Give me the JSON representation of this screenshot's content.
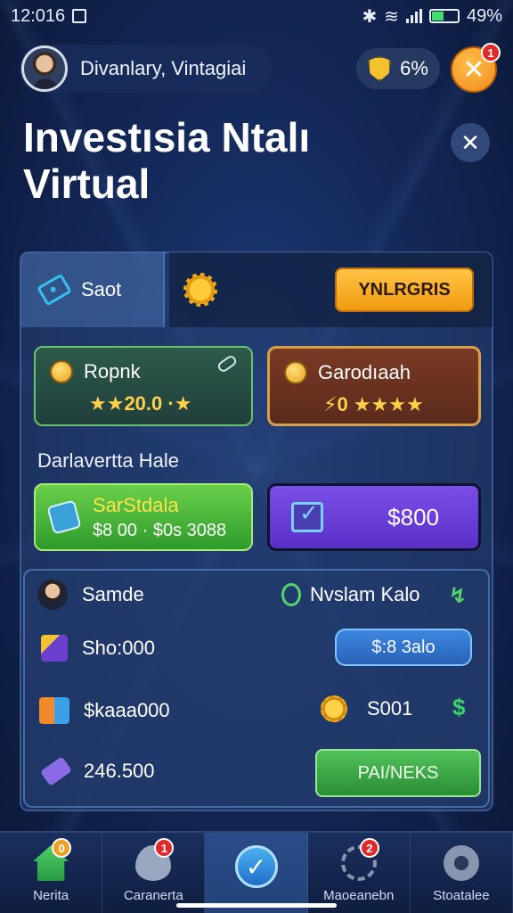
{
  "status_bar": {
    "time": "12:016",
    "battery": "49%"
  },
  "header": {
    "profile_name": "Divanlary, Vintagiai",
    "shield_value": "6%",
    "close_badge": "1"
  },
  "title": "Investısia Ntalı Virtual",
  "tabs": {
    "sort_label": "Saot",
    "action_button": "YNLRGRIS"
  },
  "cards": {
    "green": {
      "label": "Ropnk",
      "value": "★★20.0 ·★"
    },
    "brown": {
      "label": "Garodıaah",
      "value": "⚡0 ★★★★"
    }
  },
  "section": {
    "label": "Darlavertta Hale",
    "green_button": {
      "line1": "SarStdala",
      "line2": "$8 00 · $0s 3088"
    },
    "purple_button": "$800"
  },
  "list": {
    "row1": {
      "name": "Samde",
      "right": "Nvslam Kalo"
    },
    "row2": {
      "value": "Sho:000",
      "button": "$:8 3alo"
    },
    "row3": {
      "value": "$kaaa000",
      "right": "S001"
    },
    "row4": {
      "value": "246.500",
      "button": "PAI/NEKS"
    }
  },
  "bottom_nav": [
    {
      "label": "Nerita",
      "badge": "0"
    },
    {
      "label": "Caranerta",
      "badge": "1"
    },
    {
      "label": ""
    },
    {
      "label": "Maoeanebn",
      "badge": "2"
    },
    {
      "label": "Stoatalee"
    }
  ],
  "colors": {
    "accent_orange": "#f29a12",
    "accent_green": "#2e9a2c",
    "accent_purple": "#5a2fc8",
    "accent_blue": "#2a62b8"
  }
}
